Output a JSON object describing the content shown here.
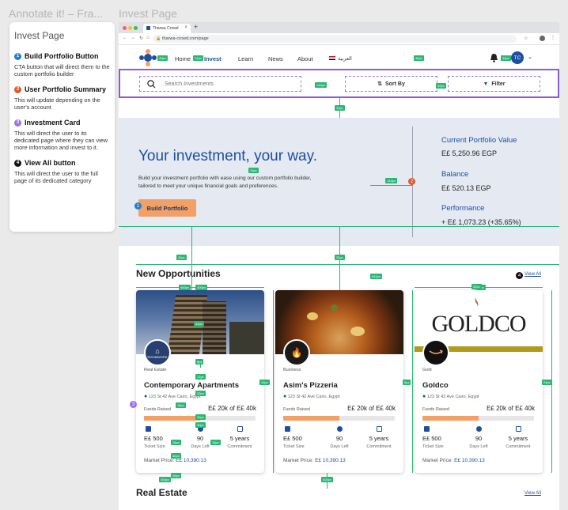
{
  "canvas": {
    "file_title": "Annotate it! – Fra...",
    "frame_title": "Invest Page"
  },
  "panel": {
    "title": "Invest Page",
    "items": [
      {
        "num": "1",
        "color": "#1e7fd4",
        "title": "Build Portfolio Button",
        "body": "CTA button that will direct them to the custom portfolio builder"
      },
      {
        "num": "2",
        "color": "#e2582b",
        "title": "User Portfolio Summary",
        "body": "This will update depending on the user's account"
      },
      {
        "num": "3",
        "color": "#9b6ff0",
        "title": "Investment Card",
        "body": "This will direct the user to its dedicated page where they can view more information and invest to it."
      },
      {
        "num": "4",
        "color": "#111111",
        "title": "View All button",
        "body": "This will direct the user to the full page of its dedicated category"
      }
    ]
  },
  "browser": {
    "tab_title": "Tharwa Crowd",
    "url": "tharwa-crowd.com/page",
    "new_tab": "+"
  },
  "nav": {
    "home": "Home",
    "invest": "Invest",
    "learn": "Learn",
    "news": "News",
    "about": "About",
    "lang": "العربية",
    "avatar": "TC"
  },
  "toolbar": {
    "search_placeholder": "Search Investments",
    "sort_label": "Sort By",
    "filter_label": "Filter"
  },
  "hero": {
    "headline": "Your investment, your way.",
    "description": "Build your investment portfolio with ease using our custom portfolio builder, tailored to meet your unique financial goals and preferences.",
    "cta": "Build Portfolio"
  },
  "portfolio": {
    "current_label": "Current Portfolio Value",
    "current_value": "E£ 5,250.96   EGP",
    "balance_label": "Balance",
    "balance_value": "E£ 520.13   EGP",
    "performance_label": "Performance",
    "performance_value": "+ E£ 1,073.23   (+35.65%)"
  },
  "sections": {
    "opportunities": "New Opportunities",
    "real_estate": "Real Estate",
    "view_all": "View All"
  },
  "cards": [
    {
      "category": "Real Estate",
      "title": "Contemporary Apartments",
      "location": "123 St 42 Ave Cairo, Egypt",
      "funds_label": "Funds Raised",
      "funds": "E£ 20k of E£ 40k",
      "progress": 0.5,
      "ticket": "E£ 500",
      "ticket_label": "Ticket Size",
      "days": "90",
      "days_label": "Days Left",
      "commit": "5 years",
      "commit_label": "Commitment",
      "market_label": "Market Price:",
      "market_value": "E£ 10,390.13",
      "logo_text": "ROOMWORK"
    },
    {
      "category": "Business",
      "title": "Asim's Pizzeria",
      "location": "123 St 42 Ave Cairo, Egypt",
      "funds_label": "Funds Raised",
      "funds": "E£ 20k of E£ 40k",
      "progress": 0.5,
      "ticket": "E£ 500",
      "ticket_label": "Ticket Size",
      "days": "90",
      "days_label": "Days Left",
      "commit": "5 years",
      "commit_label": "Commitment",
      "market_label": "Market Price:",
      "market_value": "E£ 10,390.13"
    },
    {
      "category": "Gold",
      "title": "Goldco",
      "location": "123 St 42 Ave Cairo, Egypt",
      "funds_label": "Funds Raised",
      "funds": "E£ 20k of E£ 40k",
      "progress": 0.5,
      "ticket": "E£ 500",
      "ticket_label": "Ticket Size",
      "days": "90",
      "days_label": "Days Left",
      "commit": "5 years",
      "commit_label": "Commitment",
      "market_label": "Market Price:",
      "market_value": "E£ 10,390.13",
      "brand": "GOLDCO"
    }
  ],
  "spacing_tags": [
    "40px",
    "24px",
    "32px",
    "48px",
    "144px",
    "32px",
    "32px",
    "16px",
    "144px",
    "32px",
    "32px",
    "941px",
    "400px",
    "400px",
    "24px",
    "32px",
    "16px",
    "8px",
    "24px",
    "8px",
    "12px",
    "32px",
    "16px",
    "32px",
    "40px",
    "16px",
    "16px",
    "40px",
    "40px",
    "400px",
    "400px",
    "32px"
  ],
  "colors": {
    "accent": "#1d4f9e",
    "cta": "#f2a065",
    "hero_bg": "#e4e9f2",
    "annotation": "#8c5ad6",
    "guide": "#2bb673"
  }
}
